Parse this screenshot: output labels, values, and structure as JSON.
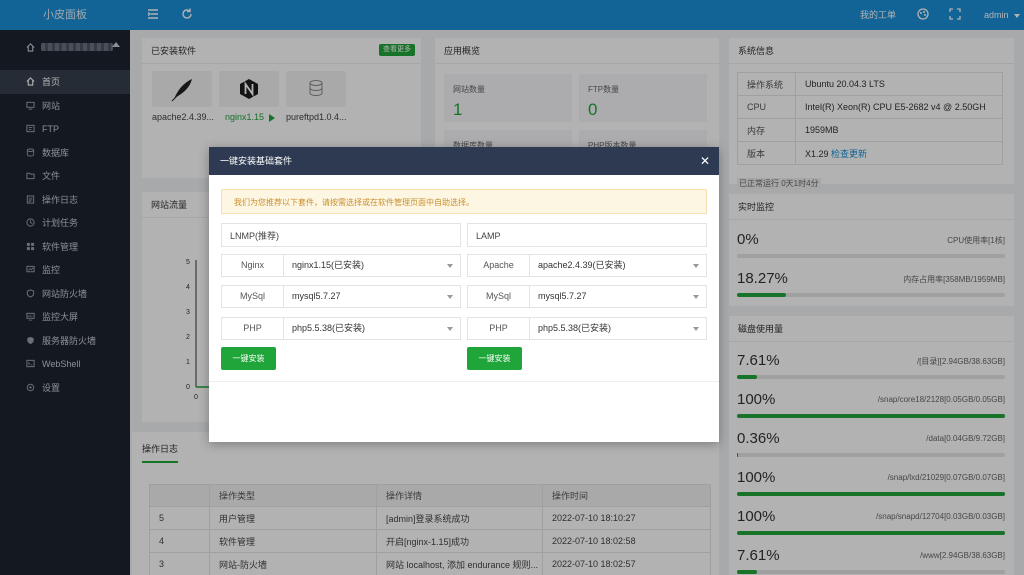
{
  "app": {
    "brand": "小皮面板"
  },
  "topbar": {
    "my_tickets": "我的工单",
    "user": "admin"
  },
  "sidebar": {
    "items": [
      {
        "label": "首页",
        "icon": "home-icon",
        "active": true
      },
      {
        "label": "网站",
        "icon": "monitor-icon"
      },
      {
        "label": "FTP",
        "icon": "ftp-icon"
      },
      {
        "label": "数据库",
        "icon": "database-icon"
      },
      {
        "label": "文件",
        "icon": "folder-icon"
      },
      {
        "label": "操作日志",
        "icon": "log-icon"
      },
      {
        "label": "计划任务",
        "icon": "clock-icon"
      },
      {
        "label": "软件管理",
        "icon": "grid-icon"
      },
      {
        "label": "监控",
        "icon": "chart-icon"
      },
      {
        "label": "网站防火墙",
        "icon": "shield-icon"
      },
      {
        "label": "监控大屏",
        "icon": "screen-icon"
      },
      {
        "label": "服务器防火墙",
        "icon": "firewall-icon"
      },
      {
        "label": "WebShell",
        "icon": "terminal-icon"
      },
      {
        "label": "设置",
        "icon": "gear-icon"
      }
    ]
  },
  "installed": {
    "title": "已安装软件",
    "more": "查看更多",
    "items": [
      {
        "name": "apache2.4.39...",
        "icon": "feather-icon"
      },
      {
        "name": "nginx1.15",
        "icon": "nginx-icon"
      },
      {
        "name": "pureftpd1.0.4...",
        "icon": "database-icon"
      }
    ]
  },
  "overview": {
    "title": "应用概览",
    "site_label": "网站数量",
    "site_value": "1",
    "ftp_label": "FTP数量",
    "ftp_value": "0",
    "db_label": "数据库数量",
    "php_label": "PHP版本数量"
  },
  "sysinfo": {
    "title": "系统信息",
    "rows": [
      {
        "k": "操作系统",
        "v": "Ubuntu 20.04.3 LTS"
      },
      {
        "k": "CPU",
        "v": "Intel(R) Xeon(R) CPU E5-2682 v4 @ 2.50GH"
      },
      {
        "k": "内存",
        "v": "1959MB"
      },
      {
        "k": "版本",
        "v": "X1.29"
      }
    ],
    "check_update": "检查更新",
    "uptime": "已正常运行 0天1时4分"
  },
  "traffic": {
    "title": "网站流量",
    "y_ticks": [
      "5",
      "4",
      "3",
      "2",
      "1",
      "0"
    ],
    "x_tick": "0"
  },
  "monitor": {
    "title": "实时监控",
    "cpu": {
      "pct": "0%",
      "text": "CPU使用率[1核]",
      "fill": 0.0
    },
    "mem": {
      "pct": "18.27%",
      "text": "内存占用率[358MB/1959MB]",
      "fill": 0.1827
    }
  },
  "disk": {
    "title": "磁盘使用量",
    "rows": [
      {
        "pct": "7.61%",
        "text": "/[目录][2.94GB/38.63GB]",
        "fill": 0.0761
      },
      {
        "pct": "100%",
        "text": "/snap/core18/2128[0.05GB/0.05GB]",
        "fill": 1.0
      },
      {
        "pct": "0.36%",
        "text": "/data[0.04GB/9.72GB]",
        "fill": 0.0036
      },
      {
        "pct": "100%",
        "text": "/snap/lxd/21029[0.07GB/0.07GB]",
        "fill": 1.0
      },
      {
        "pct": "100%",
        "text": "/snap/snapd/12704[0.03GB/0.03GB]",
        "fill": 1.0
      },
      {
        "pct": "7.61%",
        "text": "/www[2.94GB/38.63GB]",
        "fill": 0.0761
      }
    ]
  },
  "oplog": {
    "tab": "操作日志",
    "headers": [
      "",
      "操作类型",
      "操作详情",
      "操作时间"
    ],
    "rows": [
      [
        "5",
        "用户管理",
        "[admin]登录系统成功",
        "2022-07-10 18:10:27"
      ],
      [
        "4",
        "软件管理",
        "开启[nginx-1.15]成功",
        "2022-07-10 18:02:58"
      ],
      [
        "3",
        "网站-防火墙",
        "网站 localhost, 添加 endurance 规则...",
        "2022-07-10 18:02:57"
      ]
    ]
  },
  "modal": {
    "title": "一键安装基础套件",
    "notice": "我们为您推荐以下套件，请按需选择或在软件管理页面中自助选择。",
    "left": {
      "title": "LNMP(推荐)",
      "rows": [
        {
          "label": "Nginx",
          "value": "nginx1.15(已安装)"
        },
        {
          "label": "MySql",
          "value": "mysql5.7.27"
        },
        {
          "label": "PHP",
          "value": "php5.5.38(已安装)"
        }
      ],
      "button": "一键安装"
    },
    "right": {
      "title": "LAMP",
      "rows": [
        {
          "label": "Apache",
          "value": "apache2.4.39(已安装)"
        },
        {
          "label": "MySql",
          "value": "mysql5.7.27"
        },
        {
          "label": "PHP",
          "value": "php5.5.38(已安装)"
        }
      ],
      "button": "一键安装"
    }
  }
}
